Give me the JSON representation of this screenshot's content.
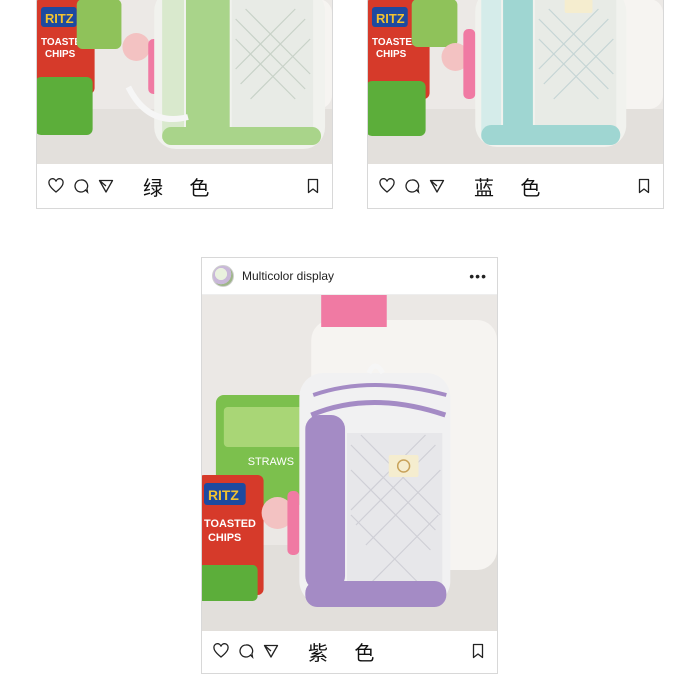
{
  "cards": {
    "green": {
      "caption": "绿 色",
      "accent": "#a9d48a",
      "icons": [
        "heart-icon",
        "comment-icon",
        "send-icon",
        "bookmark-icon"
      ]
    },
    "blue": {
      "caption": "蓝 色",
      "accent": "#9fd6d2",
      "icons": [
        "heart-icon",
        "comment-icon",
        "send-icon",
        "bookmark-icon"
      ]
    },
    "purple": {
      "username": "Multicolor display",
      "more_label": "•••",
      "caption": "紫 色",
      "accent": "#a48bc5",
      "icons": [
        "heart-icon",
        "comment-icon",
        "send-icon",
        "bookmark-icon"
      ]
    }
  },
  "photo_labels": {
    "ritz": "RITZ",
    "toasted": "TOASTED",
    "chips": "CHIPS",
    "straws": "STRAWS"
  }
}
